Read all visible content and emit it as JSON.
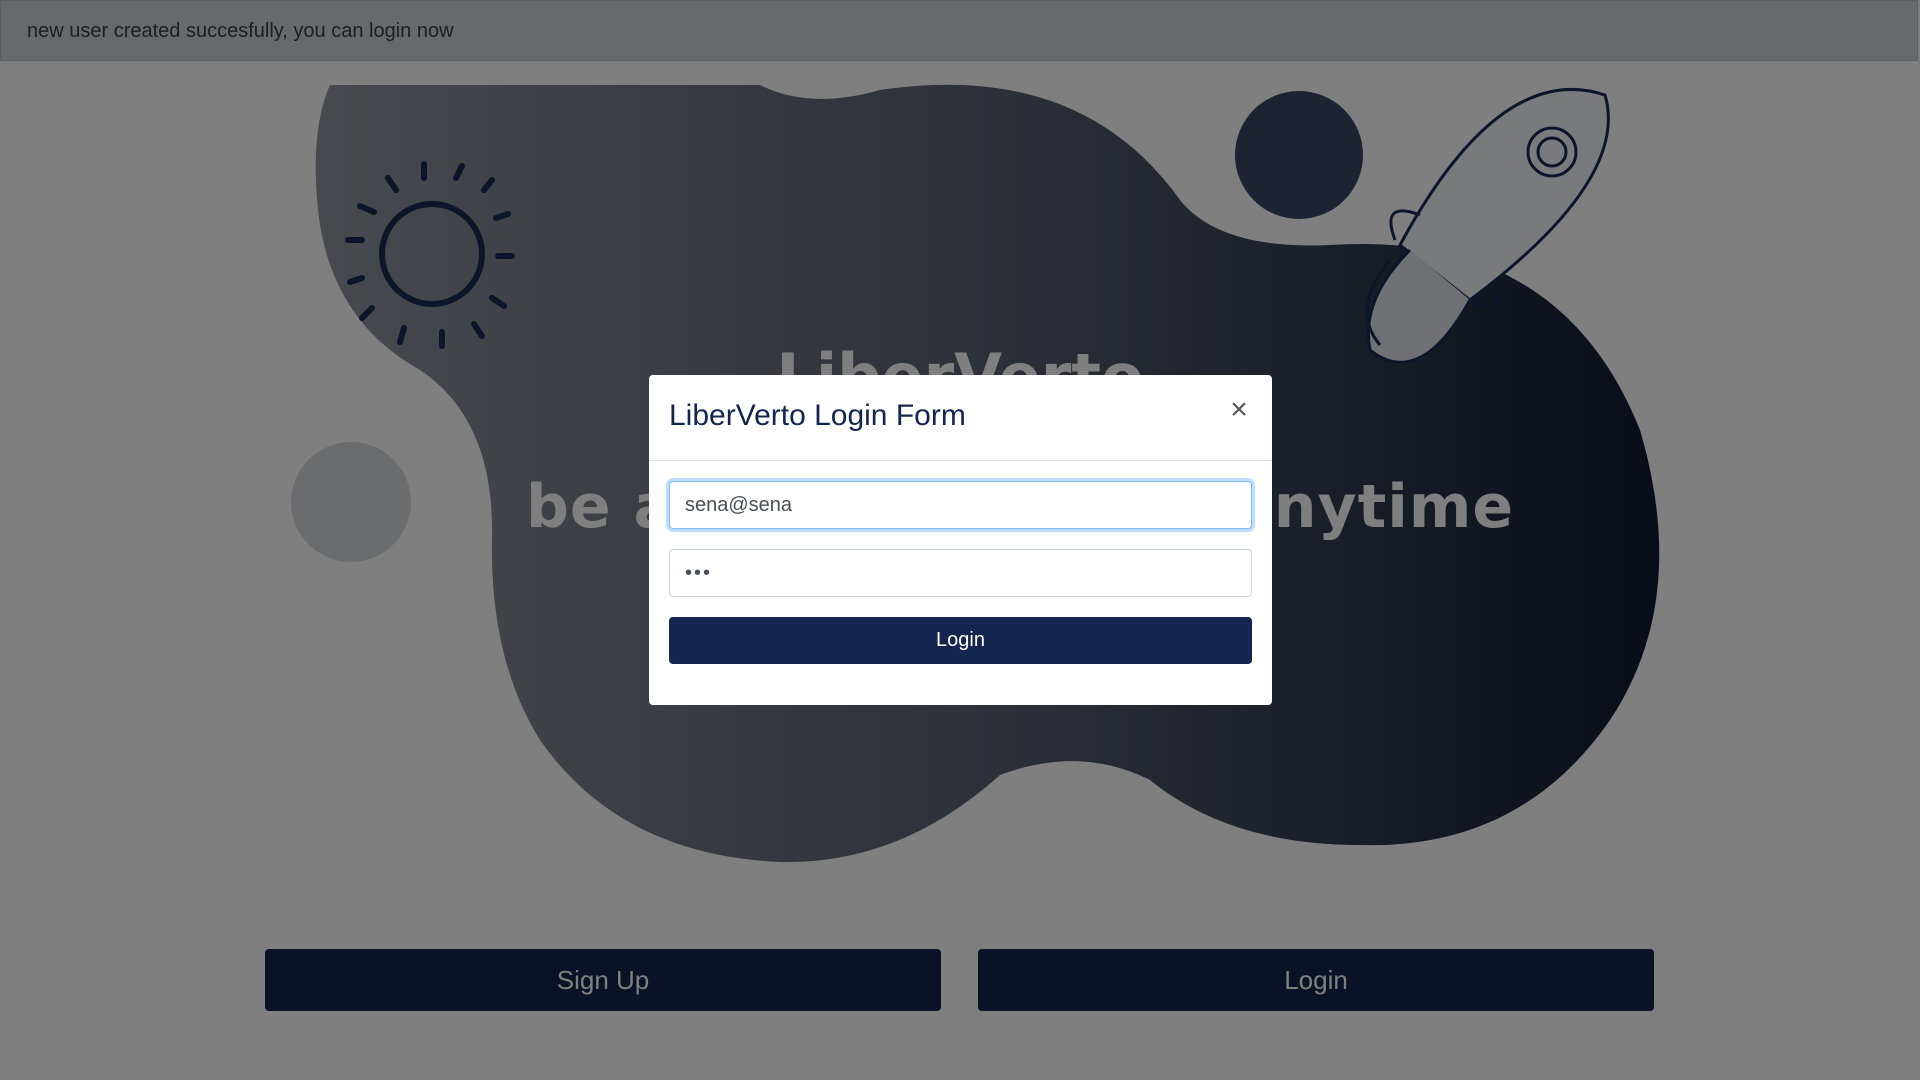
{
  "alert": {
    "message": "new user created succesfully, you can login now"
  },
  "hero": {
    "tagline": "be an inspiration at anytime",
    "title": "LiberVerto",
    "gradient_start": "#8f949c",
    "gradient_end": "#111a33"
  },
  "buttons": {
    "signup_label": "Sign Up",
    "login_label": "Login"
  },
  "modal": {
    "title": "LiberVerto Login Form",
    "close_glyph": "×",
    "email_value": "sena@sena",
    "password_value": "•••",
    "submit_label": "Login"
  },
  "colors": {
    "primary": "#14254f",
    "alert_bg": "#cfd4da",
    "focus": "#80bdff"
  }
}
